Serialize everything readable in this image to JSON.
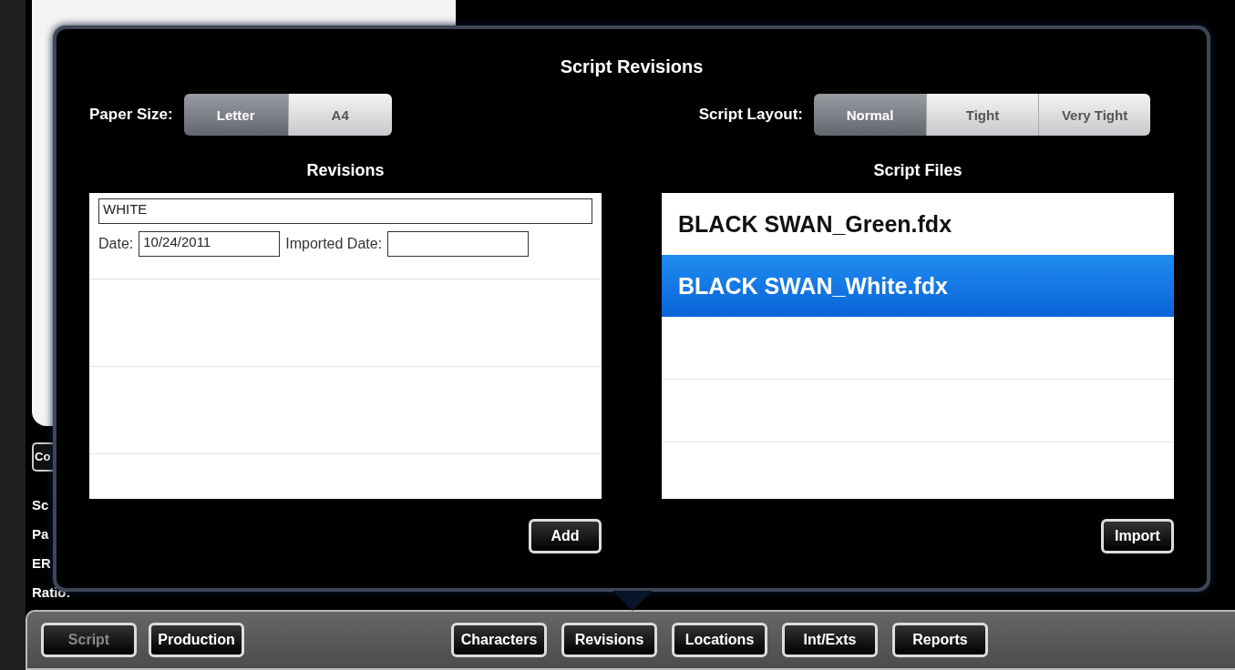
{
  "background": {
    "button": "Co",
    "labels": [
      "Sc",
      "Pa",
      "ER",
      "Ratio:"
    ]
  },
  "popover": {
    "title": "Script Revisions",
    "paper_size": {
      "label": "Paper Size:",
      "options": [
        {
          "label": "Letter",
          "selected": true
        },
        {
          "label": "A4",
          "selected": false
        }
      ]
    },
    "script_layout": {
      "label": "Script Layout:",
      "options": [
        {
          "label": "Normal",
          "selected": true
        },
        {
          "label": "Tight",
          "selected": false
        },
        {
          "label": "Very Tight",
          "selected": false
        }
      ]
    },
    "revisions": {
      "heading": "Revisions",
      "name": "WHITE",
      "date_label": "Date:",
      "date": "10/24/2011",
      "imported_label": "Imported Date:",
      "button": "Add"
    },
    "script_files": {
      "heading": "Script Files",
      "files": [
        {
          "name": "BLACK SWAN_Green.fdx",
          "selected": false
        },
        {
          "name": "BLACK SWAN_White.fdx",
          "selected": true
        }
      ],
      "button": "Import"
    }
  },
  "toolbar": [
    {
      "label": "Script",
      "selected": true
    },
    {
      "label": "Production",
      "selected": false
    },
    {
      "label": "Characters",
      "selected": false
    },
    {
      "label": "Revisions",
      "selected": false
    },
    {
      "label": "Locations",
      "selected": false
    },
    {
      "label": "Int/Exts",
      "selected": false
    },
    {
      "label": "Reports",
      "selected": false
    }
  ]
}
